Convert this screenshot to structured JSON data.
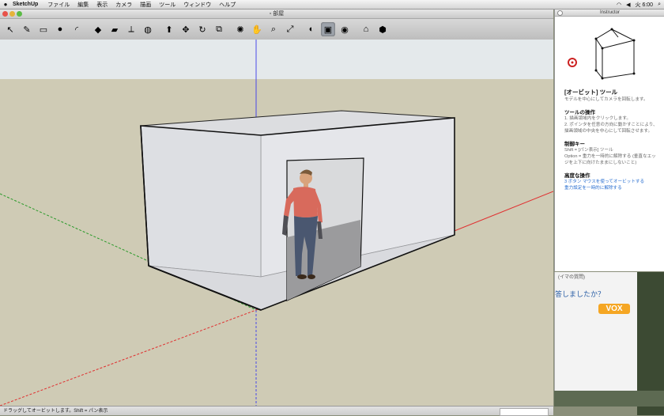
{
  "menubar": {
    "app_name": "SketchUp",
    "items": [
      "ファイル",
      "編集",
      "表示",
      "カメラ",
      "描画",
      "ツール",
      "ウィンドウ",
      "ヘルプ"
    ],
    "clock": "火 6:00"
  },
  "window": {
    "title": "部屋"
  },
  "toolbar": {
    "tools": [
      {
        "name": "select",
        "icon": "↖"
      },
      {
        "name": "pencil",
        "icon": "✎"
      },
      {
        "name": "rectangle",
        "icon": "▭"
      },
      {
        "name": "circle",
        "icon": "●"
      },
      {
        "name": "arc",
        "icon": "◜"
      },
      {
        "name": "make-component",
        "icon": "◆"
      },
      {
        "name": "eraser",
        "icon": "▰"
      },
      {
        "name": "tape-measure",
        "icon": "⟂"
      },
      {
        "name": "paint-bucket",
        "icon": "◍"
      },
      {
        "name": "push-pull",
        "icon": "⬆"
      },
      {
        "name": "move",
        "icon": "✥"
      },
      {
        "name": "rotate",
        "icon": "↻"
      },
      {
        "name": "offset",
        "icon": "⧉"
      },
      {
        "name": "orbit",
        "icon": "✺"
      },
      {
        "name": "pan",
        "icon": "✋"
      },
      {
        "name": "zoom",
        "icon": "⌕"
      },
      {
        "name": "zoom-extents",
        "icon": "⤢"
      },
      {
        "name": "previous-view",
        "icon": "◐"
      },
      {
        "name": "iso-view",
        "icon": "▣"
      },
      {
        "name": "position-camera",
        "icon": "◉"
      },
      {
        "name": "3d-warehouse",
        "icon": "⌂"
      },
      {
        "name": "components",
        "icon": "⬢"
      }
    ]
  },
  "status_bar": {
    "text": "ドラッグしてオービットします。Shift = パン表示"
  },
  "instructor": {
    "title": "Instructor",
    "heading": "[オービット] ツール",
    "description": "モデルを中心にしてカメラを回転します。",
    "operations_heading": "ツールの操作",
    "operations": [
      "1. 描画領域内をクリックします。",
      "2. ポインタを任意の方向に動かすことにより、描画領域の中央を中心にして回転させます。"
    ],
    "modifiers_heading": "制御キー",
    "modifiers": [
      "Shift = [パン表示] ツール",
      "Option = 重力を一時的に解除する (垂直なエッジを上下に向けたままにしないこと)"
    ],
    "advanced_heading": "高度な操作",
    "advanced_links": [
      "3 ボタン マウスを使ってオービットする",
      "重力設定を一時的に解除する"
    ]
  },
  "background_window": {
    "text1": "(イマの質問)",
    "text2": "答しましたか？",
    "logo": "VOX"
  },
  "colors": {
    "sky": "#e4e9eb",
    "ground": "#cfcbb5",
    "wall": "#e4e5e7",
    "blue_axis": "#4a4ae8",
    "red_axis": "#e03030",
    "green_axis": "#2a9a2a",
    "link": "#2a6fd0",
    "vox": "#f5a623"
  }
}
